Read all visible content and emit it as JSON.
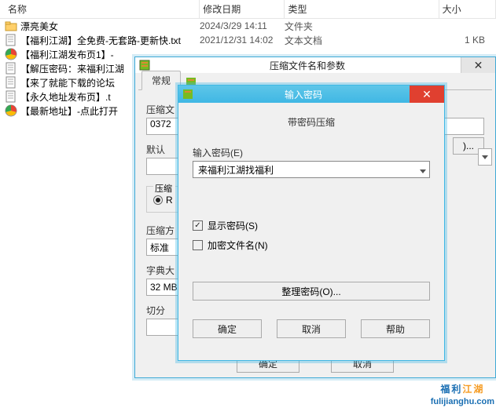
{
  "header": {
    "name": "名称",
    "date": "修改日期",
    "type": "类型",
    "size": "大小"
  },
  "files": [
    {
      "icon": "folder",
      "name": "漂亮美女",
      "date": "2024/3/29 14:11",
      "type": "文件夹",
      "size": ""
    },
    {
      "icon": "txt",
      "name": "【福利江湖】全免费-无套路-更新快.txt",
      "date": "2021/12/31 14:02",
      "type": "文本文档",
      "size": "1 KB"
    },
    {
      "icon": "chrome",
      "name": "【福利江湖发布页1】-",
      "date": "",
      "type": "",
      "size": ""
    },
    {
      "icon": "txt",
      "name": "【解压密码：来福利江湖",
      "date": "",
      "type": "",
      "size": ""
    },
    {
      "icon": "txt",
      "name": "【来了就能下载的论坛",
      "date": "",
      "type": "",
      "size": ""
    },
    {
      "icon": "txt",
      "name": "【永久地址发布页】.t",
      "date": "",
      "type": "",
      "size": ""
    },
    {
      "icon": "chrome",
      "name": "【最新地址】-点此打开",
      "date": "",
      "type": "",
      "size": ""
    }
  ],
  "dlg1": {
    "title": "压缩文件名和参数",
    "tab": "常规",
    "archiveLabel": "压缩文",
    "archiveValue": "0372",
    "defaultLabel": "默认",
    "browse": ")...",
    "formatGroup": "压缩",
    "formatOption": "R",
    "methodLabel": "压缩方",
    "methodValue": "标准",
    "dictLabel": "字典大",
    "dictValue": "32 MB",
    "splitLabel": "切分",
    "ok": "确定",
    "cancel": "取消"
  },
  "dlg2": {
    "title": "输入密码",
    "subtitle": "带密码压缩",
    "pwLabel": "输入密码(E)",
    "pwValue": "来福利江湖找福利",
    "showPw": "显示密码(S)",
    "encryptNames": "加密文件名(N)",
    "organize": "整理密码(O)...",
    "ok": "确定",
    "cancel": "取消",
    "help": "帮助"
  },
  "watermark": {
    "main1": "福利",
    "main2": "江湖",
    "sub": "fulijianghu.com"
  }
}
